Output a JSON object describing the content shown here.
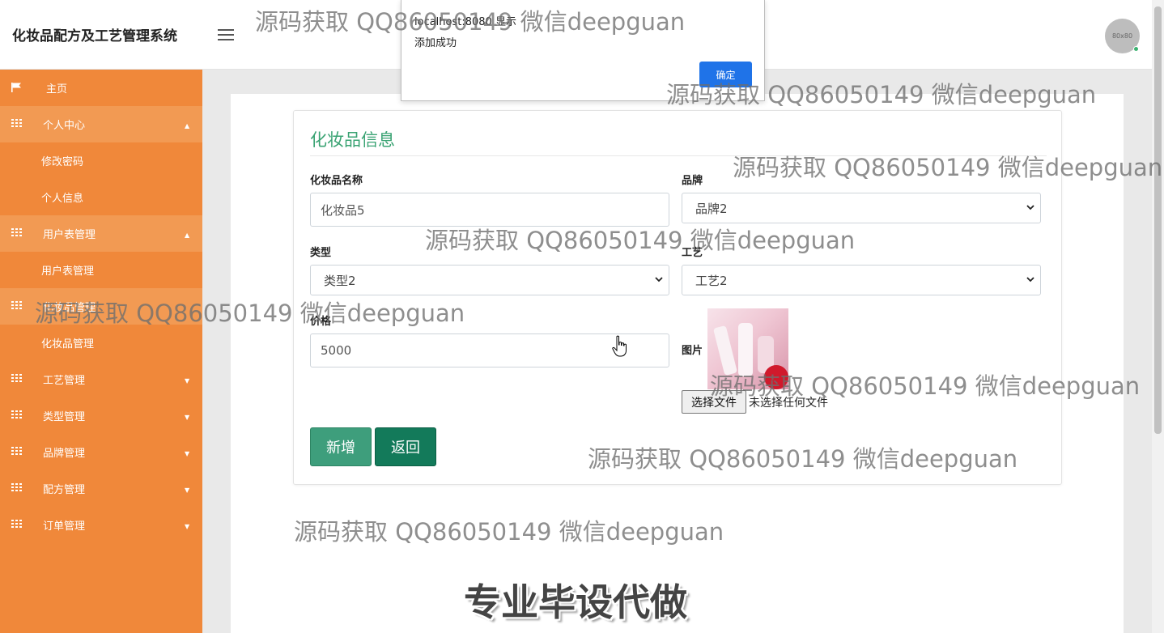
{
  "app": {
    "title": "化妆品配方及工艺管理系统",
    "avatar_text": "80x80"
  },
  "sidebar": {
    "items": [
      {
        "label": "主页"
      },
      {
        "label": "个人中心"
      },
      {
        "label": "修改密码"
      },
      {
        "label": "个人信息"
      },
      {
        "label": "用户表管理"
      },
      {
        "label": "用户表管理"
      },
      {
        "label": "化妆品管理"
      },
      {
        "label": "化妆品管理"
      },
      {
        "label": "工艺管理"
      },
      {
        "label": "类型管理"
      },
      {
        "label": "品牌管理"
      },
      {
        "label": "配方管理"
      },
      {
        "label": "订单管理"
      }
    ]
  },
  "form": {
    "title": "化妆品信息",
    "name": {
      "label": "化妆品名称",
      "value": "化妆品5"
    },
    "brand": {
      "label": "品牌",
      "value": "品牌2"
    },
    "type": {
      "label": "类型",
      "value": "类型2"
    },
    "process": {
      "label": "工艺",
      "value": "工艺2"
    },
    "price": {
      "label": "价格",
      "value": "5000"
    },
    "image": {
      "label": "图片",
      "choose_button": "选择文件",
      "file_status": "未选择任何文件"
    },
    "add_button": "新增",
    "back_button": "返回"
  },
  "dialog": {
    "origin": "localhost:8080 显示",
    "message": "添加成功",
    "ok_button": "确定"
  },
  "watermarks": [
    "源码获取 QQ86050149 微信deepguan",
    "源码获取 QQ86050149 微信deepguan",
    "源码获取 QQ86050149 微信deepguan",
    "源码获取 QQ86050149 微信deepguan",
    "源码获取 QQ86050149 微信deepguan",
    "源码获取 QQ86050149 微信deepguan",
    "源码获取 QQ86050149 微信deepguan",
    "源码获取 QQ86050149 微信deepguan"
  ],
  "banner": "专业毕设代做",
  "colors": {
    "sidebar": "#f0883a",
    "accent": "#3aa373",
    "add_button": "#3e9e7c",
    "back_button": "#137a5a",
    "dialog_ok": "#1f73e8"
  }
}
